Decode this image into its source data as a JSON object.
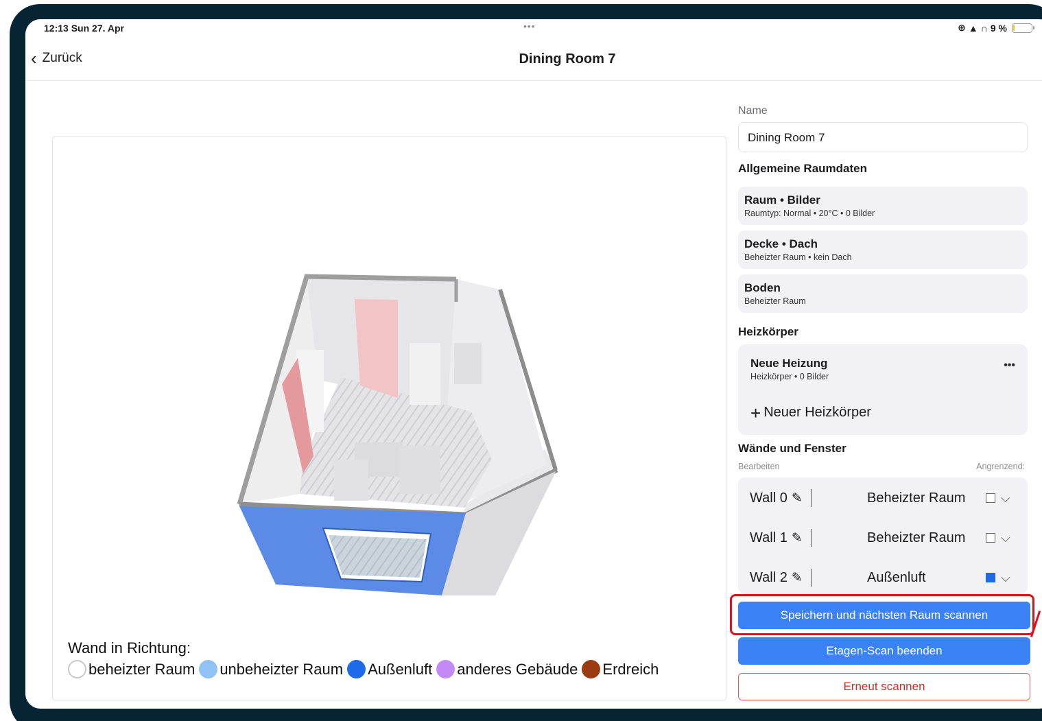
{
  "status": {
    "time": "12:13  Sun 27. Apr",
    "more": "•••",
    "battery": "9 %",
    "battery_fraction": 0.09
  },
  "nav": {
    "back_label": "Zurück",
    "title": "Dining Room 7"
  },
  "legend": {
    "title": "Wand in Richtung:",
    "items": [
      {
        "label": "beheizter Raum",
        "color": "#ffffff"
      },
      {
        "label": "unbeheizter Raum",
        "color": "#90c2f5"
      },
      {
        "label": "Außenluft",
        "color": "#1e6ae8"
      },
      {
        "label": "anderes Gebäude",
        "color": "#c38af5"
      },
      {
        "label": "Erdreich",
        "color": "#9a3b12"
      }
    ]
  },
  "form": {
    "name_label": "Name",
    "name_value": "Dining Room 7",
    "general_title": "Allgemeine Raumdaten",
    "cards": [
      {
        "title": "Raum • Bilder",
        "subtitle": "Raumtyp: Normal  •  20°C • 0 Bilder"
      },
      {
        "title": "Decke  •  Dach",
        "subtitle": "Beheizter Raum  •  kein Dach"
      },
      {
        "title": "Boden",
        "subtitle": "Beheizter Raum"
      }
    ],
    "heating_title": "Heizkörper",
    "heater": {
      "title": "Neue Heizung",
      "subtitle": "Heizkörper • 0 Bilder",
      "more": "•••"
    },
    "add_heater": "Neuer Heizkörper",
    "walls_title": "Wände und Fenster",
    "walls_edit_label": "Bearbeiten",
    "walls_adjacent_label": "Angrenzend:",
    "walls": [
      {
        "name": "Wall 0",
        "adjacent": "Beheizter Raum",
        "color": "#ffffff"
      },
      {
        "name": "Wall 1",
        "adjacent": "Beheizter Raum",
        "color": "#ffffff"
      },
      {
        "name": "Wall 2",
        "adjacent": "Außenluft",
        "color": "#1e6ae8"
      }
    ]
  },
  "buttons": {
    "save_next": "Speichern und nächsten Raum scannen",
    "finish": "Etagen-Scan beenden",
    "rescan": "Erneut scannen"
  }
}
